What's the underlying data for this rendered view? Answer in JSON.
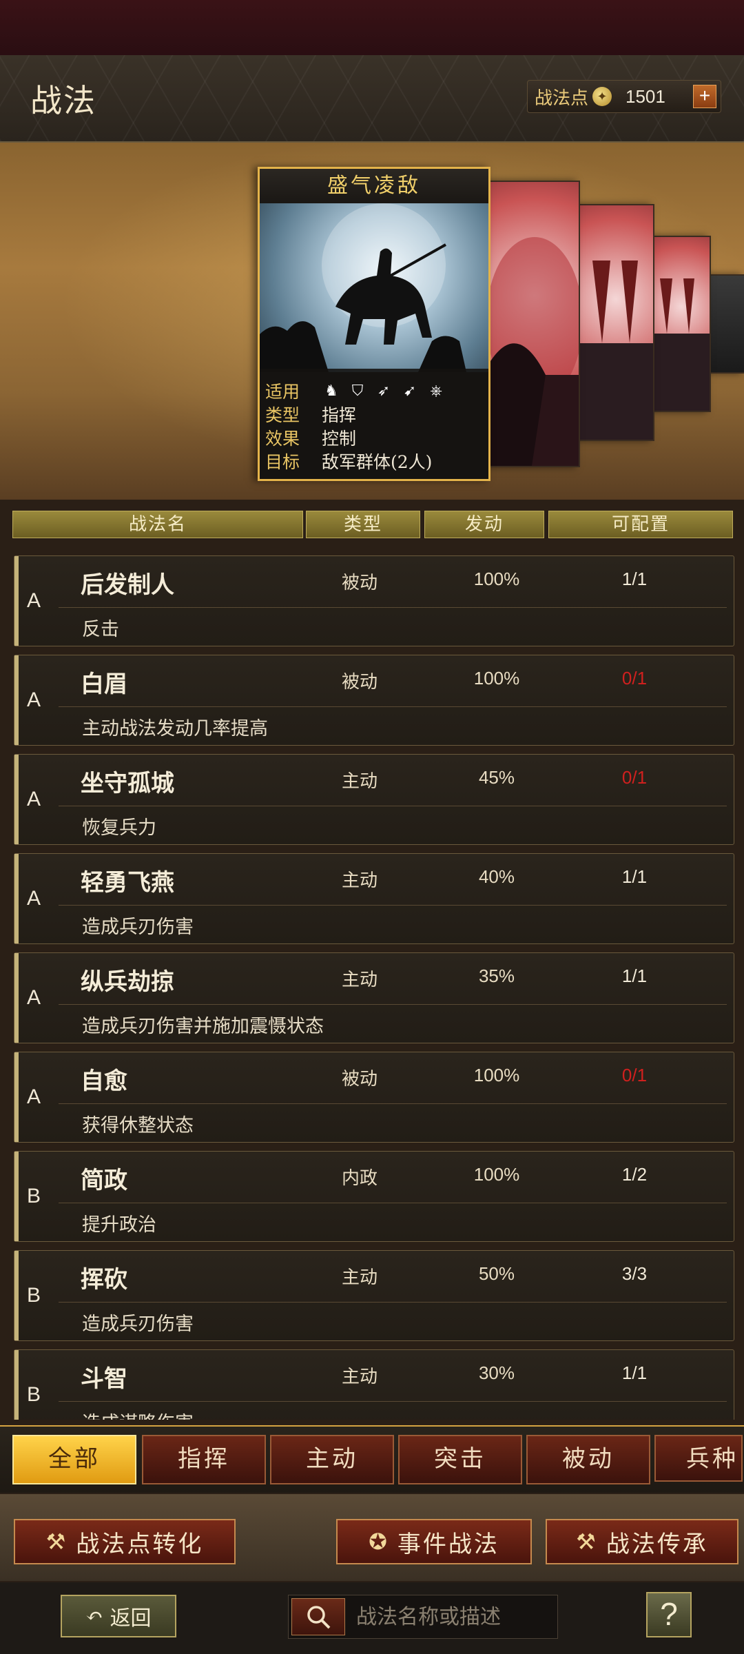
{
  "header": {
    "title": "战法",
    "points_label": "战法点",
    "points_value": "1501",
    "plus_label": "+"
  },
  "featured_card": {
    "title": "盛气凌敌",
    "fields": [
      {
        "key": "适用",
        "value": ""
      },
      {
        "key": "类型",
        "value": "指挥"
      },
      {
        "key": "效果",
        "value": "控制"
      },
      {
        "key": "目标",
        "value": "敌军群体(2人)"
      }
    ],
    "troop_icons": [
      "cavalry-icon",
      "shield-icon",
      "bow-icon",
      "spear-icon",
      "wheel-icon"
    ]
  },
  "columns": [
    "战法名",
    "类型",
    "发动",
    "可配置"
  ],
  "tactics": [
    {
      "grade": "A",
      "name": "后发制人",
      "type": "被动",
      "rate": "100%",
      "config": "1/1",
      "config_full": false,
      "desc": "反击"
    },
    {
      "grade": "A",
      "name": "白眉",
      "type": "被动",
      "rate": "100%",
      "config": "0/1",
      "config_full": true,
      "desc": "主动战法发动几率提高"
    },
    {
      "grade": "A",
      "name": "坐守孤城",
      "type": "主动",
      "rate": "45%",
      "config": "0/1",
      "config_full": true,
      "desc": "恢复兵力"
    },
    {
      "grade": "A",
      "name": "轻勇飞燕",
      "type": "主动",
      "rate": "40%",
      "config": "1/1",
      "config_full": false,
      "desc": "造成兵刃伤害"
    },
    {
      "grade": "A",
      "name": "纵兵劫掠",
      "type": "主动",
      "rate": "35%",
      "config": "1/1",
      "config_full": false,
      "desc": "造成兵刃伤害并施加震慑状态"
    },
    {
      "grade": "A",
      "name": "自愈",
      "type": "被动",
      "rate": "100%",
      "config": "0/1",
      "config_full": true,
      "desc": "获得休整状态"
    },
    {
      "grade": "B",
      "name": "简政",
      "type": "内政",
      "rate": "100%",
      "config": "1/2",
      "config_full": false,
      "desc": "提升政治"
    },
    {
      "grade": "B",
      "name": "挥砍",
      "type": "主动",
      "rate": "50%",
      "config": "3/3",
      "config_full": false,
      "desc": "造成兵刃伤害"
    },
    {
      "grade": "B",
      "name": "斗智",
      "type": "主动",
      "rate": "30%",
      "config": "1/1",
      "config_full": false,
      "desc": "造成谋略伤害"
    }
  ],
  "filters": [
    "全部",
    "指挥",
    "主动",
    "突击",
    "被动",
    "兵种"
  ],
  "active_filter": "全部",
  "actions": {
    "convert": "战法点转化",
    "event": "事件战法",
    "inherit": "战法传承"
  },
  "bottom": {
    "back_label": "返回",
    "search_placeholder": "战法名称或描述",
    "help_label": "?"
  },
  "colors": {
    "accent_gold": "#e4b34a",
    "config_full_red": "#d0201e"
  }
}
